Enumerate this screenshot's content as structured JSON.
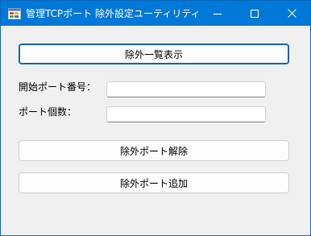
{
  "window": {
    "title": "管理TCPポート 除外設定ユーティリティ",
    "icon": "app-window-icon",
    "controls": {
      "minimize_icon": "minimize-icon",
      "maximize_icon": "maximize-icon",
      "close_icon": "close-icon"
    }
  },
  "form": {
    "show_list_button": "除外一覧表示",
    "start_port_label": "開始ポート番号：",
    "start_port_value": "",
    "port_count_label": "ポート個数：",
    "port_count_value": "",
    "remove_exclusion_button": "除外ポート解除",
    "add_exclusion_button": "除外ポート追加"
  },
  "colors": {
    "titlebar": "#0078d7",
    "window_background": "#f0f0f0",
    "default_button_border": "#0067c0"
  }
}
